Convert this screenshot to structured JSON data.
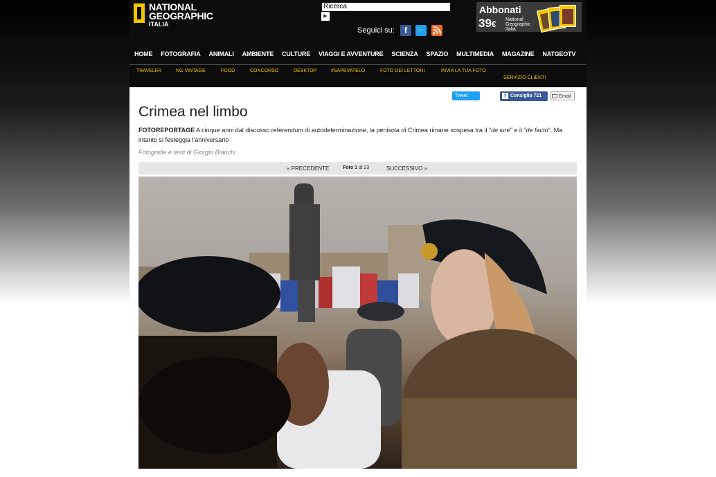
{
  "header": {
    "logo": {
      "line1": "NATIONAL",
      "line2": "GEOGRAPHIC",
      "line3": "ITALIA"
    },
    "search": {
      "placeholder": "Ricerca",
      "value": "Ricerca"
    },
    "follow_label": "Seguici su:",
    "social_icons": [
      "facebook-icon",
      "twitter-icon",
      "rss-icon"
    ],
    "subscribe": {
      "title": "Abbonati",
      "price": "39",
      "currency": "€",
      "caption": "National Geographic Italia"
    },
    "main_nav": [
      "HOME",
      "FOTOGRAFIA",
      "ANIMALI",
      "AMBIENTE",
      "CULTURE",
      "VIAGGI E AVVENTURE",
      "SCIENZA",
      "SPAZIO",
      "MULTIMEDIA",
      "MAGAZINE",
      "NATGEOTV"
    ],
    "sub_nav": [
      "TRAVELER",
      "NG VINTAGE",
      "FOOD",
      "CONCORSO",
      "DESKTOP",
      "#SAPEVATELO",
      "FOTO DEI LETTORI",
      "INVIA LA TUA FOTO",
      "SERVIZIO CLIENTI"
    ]
  },
  "share": {
    "tweet": "Tweet",
    "facebook": "Consiglia 721",
    "email": "Email"
  },
  "article": {
    "title": "Crimea nel limbo",
    "kicker": "FOTOREPORTAGE",
    "lead_1": " A cinque anni dal discusso referendum di autodeterminazione, la penisola di Crimea rimane sospesa tra il \"",
    "lead_em1": "de iure",
    "lead_2": "\" e il \"",
    "lead_em2": "de facto",
    "lead_3": "\". Ma intanto si festeggia l'anniversario",
    "byline": "Fotografie e testi di Giorgio Bianchi"
  },
  "gallery": {
    "prev": "« PRECEDENTE",
    "count_prefix": "Foto",
    "current": "1",
    "count_sep": "di",
    "total": "23",
    "next": "SUCCESSIVO »"
  },
  "colors": {
    "brand_yellow": "#f6c500",
    "header_bg": "#0c0c0c",
    "facebook": "#3b5998",
    "twitter": "#1da1f2",
    "rss": "#f26522"
  }
}
